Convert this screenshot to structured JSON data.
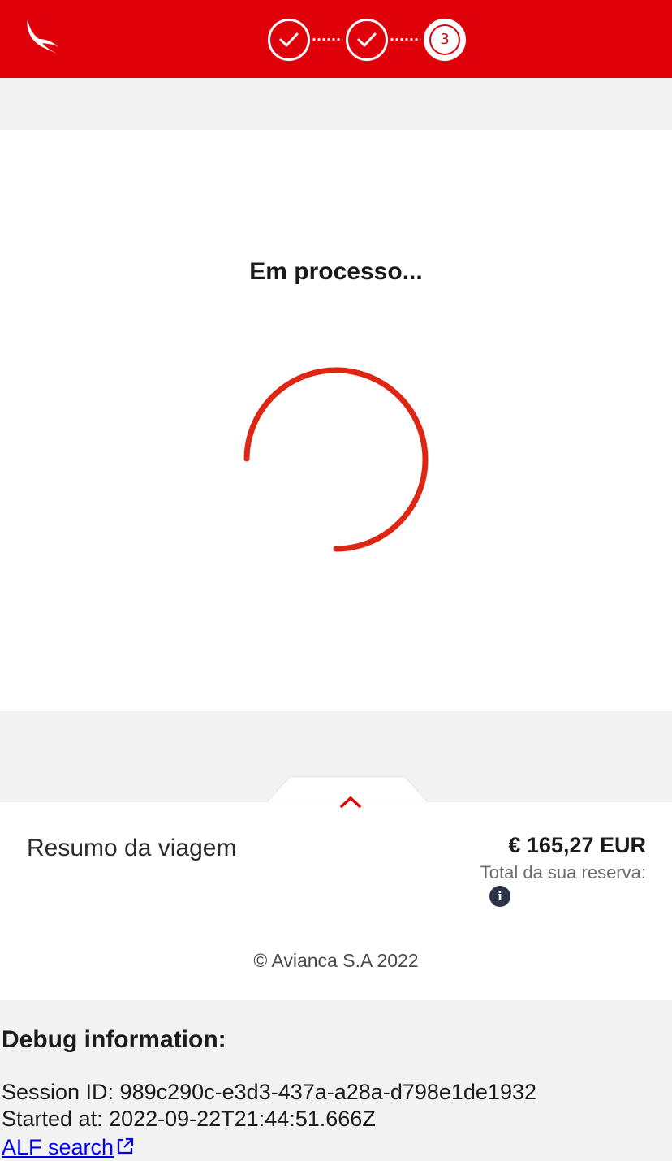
{
  "header": {
    "logo": "avianca-bird-logo",
    "steps": [
      {
        "state": "done",
        "icon": "check-icon"
      },
      {
        "state": "done",
        "icon": "check-icon"
      },
      {
        "state": "current",
        "label": "3"
      }
    ]
  },
  "processing": {
    "title": "Em processo..."
  },
  "summary": {
    "label": "Resumo da viagem",
    "price": "€ 165,27 EUR",
    "total_label": "Total da sua reserva:",
    "info_icon_glyph": "i"
  },
  "footer": {
    "copyright": "© Avianca S.A 2022"
  },
  "debug": {
    "title": "Debug information:",
    "session_line": "Session ID: 989c290c-e3d3-437a-a28a-d798e1de1932",
    "started_line": "Started at: 2022-09-22T21:44:51.666Z",
    "alf_link": "ALF search"
  },
  "colors": {
    "brand_red": "#e0000a",
    "spinner_red": "#de2614",
    "info_dark": "#2b3447",
    "link_blue": "#0000ee"
  }
}
